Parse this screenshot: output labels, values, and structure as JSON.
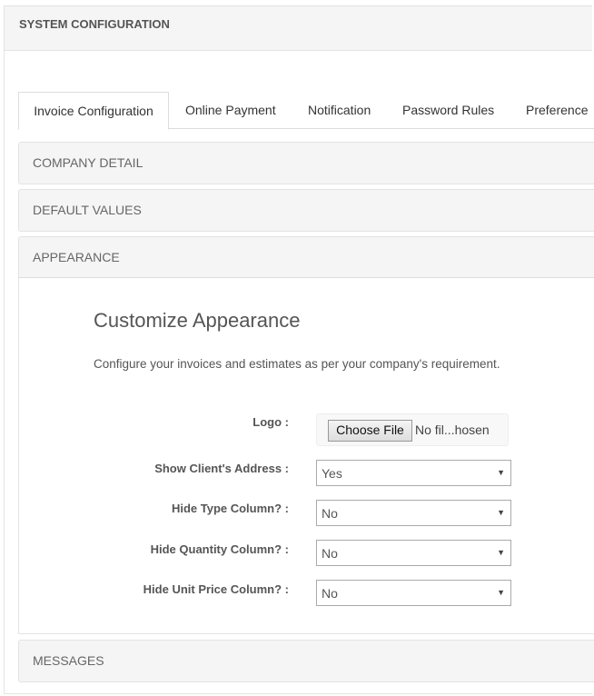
{
  "header": {
    "title": "SYSTEM CONFIGURATION"
  },
  "tabs": [
    {
      "label": "Invoice Configuration",
      "active": true
    },
    {
      "label": "Online Payment"
    },
    {
      "label": "Notification"
    },
    {
      "label": "Password Rules"
    },
    {
      "label": "Preference"
    }
  ],
  "sections": {
    "company": "COMPANY DETAIL",
    "defaults": "DEFAULT VALUES",
    "appearance": "APPEARANCE",
    "messages": "MESSAGES"
  },
  "appearance": {
    "title": "Customize Appearance",
    "description": "Configure your invoices and estimates as per your company's requirement.",
    "logo": {
      "label": "Logo :",
      "button": "Choose File",
      "status": "No fil...hosen"
    },
    "fields": [
      {
        "label": "Show Client's Address :",
        "value": "Yes"
      },
      {
        "label": "Hide Type Column? :",
        "value": "No"
      },
      {
        "label": "Hide Quantity Column? :",
        "value": "No"
      },
      {
        "label": "Hide Unit Price Column? :",
        "value": "No"
      }
    ],
    "caret_icon": "caret-down-icon"
  }
}
